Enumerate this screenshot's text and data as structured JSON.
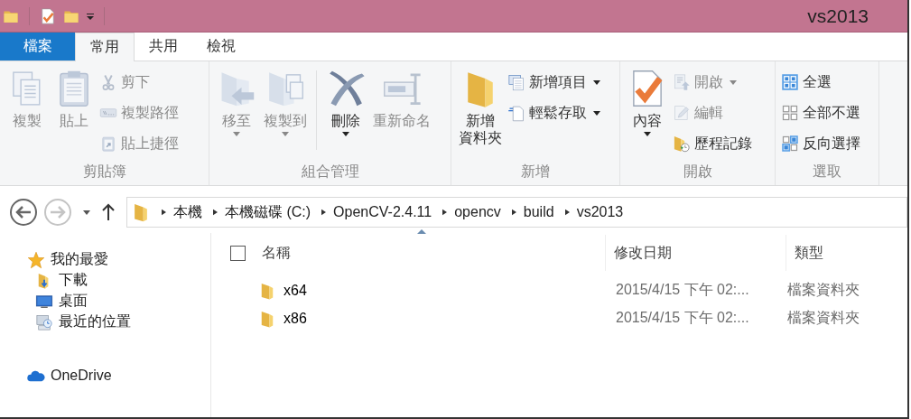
{
  "window": {
    "title": "vs2013"
  },
  "quick_access": [
    {
      "kind": "folder"
    },
    {
      "kind": "separator"
    },
    {
      "kind": "properties"
    },
    {
      "kind": "newfolder"
    },
    {
      "kind": "caret"
    }
  ],
  "tabs": [
    {
      "label": "檔案",
      "kind": "file",
      "selected": false
    },
    {
      "label": "常用",
      "kind": "tab",
      "selected": true
    },
    {
      "label": "共用",
      "kind": "tab",
      "selected": false
    },
    {
      "label": "檢視",
      "kind": "tab",
      "selected": false
    }
  ],
  "ribbon": {
    "groups": [
      {
        "label": "剪貼簿",
        "items": [
          {
            "kind": "large",
            "label": "複製",
            "disabled": true,
            "dropdown": false
          },
          {
            "kind": "large",
            "label": "貼上",
            "disabled": true,
            "dropdown": false
          },
          {
            "kind": "small",
            "label": "剪下",
            "disabled": true,
            "dropdown": false
          },
          {
            "kind": "small",
            "label": "複製路徑",
            "disabled": true,
            "dropdown": false
          },
          {
            "kind": "small",
            "label": "貼上捷徑",
            "disabled": true,
            "dropdown": false
          }
        ]
      },
      {
        "label": "組合管理",
        "items": [
          {
            "kind": "large",
            "label": "移至",
            "disabled": true,
            "dropdown": true
          },
          {
            "kind": "large",
            "label": "複製到",
            "disabled": true,
            "dropdown": true
          },
          {
            "kind": "separator"
          },
          {
            "kind": "large",
            "label": "刪除",
            "disabled": false,
            "dropdown": true
          },
          {
            "kind": "large",
            "label": "重新命名",
            "disabled": true,
            "dropdown": false
          }
        ]
      },
      {
        "label": "新增",
        "items": [
          {
            "kind": "large",
            "lines": [
              "新增",
              "資料夾"
            ],
            "disabled": false,
            "dropdown": false
          },
          {
            "kind": "small",
            "label": "新增項目",
            "disabled": false,
            "dropdown": true
          },
          {
            "kind": "small",
            "label": "輕鬆存取",
            "disabled": false,
            "dropdown": true
          }
        ]
      },
      {
        "label": "開啟",
        "items": [
          {
            "kind": "large",
            "label": "內容",
            "disabled": false,
            "dropdown": true
          },
          {
            "kind": "small",
            "label": "開啟",
            "disabled": true,
            "dropdown": true
          },
          {
            "kind": "small",
            "label": "編輯",
            "disabled": true,
            "dropdown": false
          },
          {
            "kind": "small",
            "label": "歷程記錄",
            "disabled": false,
            "dropdown": false
          }
        ]
      },
      {
        "label": "選取",
        "items": [
          {
            "kind": "small",
            "label": "全選",
            "disabled": false,
            "dropdown": false
          },
          {
            "kind": "small",
            "label": "全部不選",
            "disabled": false,
            "dropdown": false
          },
          {
            "kind": "small",
            "label": "反向選擇",
            "disabled": false,
            "dropdown": false
          }
        ]
      }
    ]
  },
  "navigation": {
    "back": {
      "disabled": false
    },
    "forward": {
      "disabled": true
    }
  },
  "address": {
    "crumbs": [
      "本機",
      "本機磁碟 (C:)",
      "OpenCV-2.4.11",
      "opencv",
      "build",
      "vs2013"
    ]
  },
  "sidebar": {
    "items": [
      {
        "label": "我的最愛",
        "kind": "favorites",
        "children": [
          {
            "label": "下載",
            "kind": "downloads"
          },
          {
            "label": "桌面",
            "kind": "desktop"
          },
          {
            "label": "最近的位置",
            "kind": "recent"
          }
        ]
      },
      {
        "label": "OneDrive",
        "kind": "cloud"
      }
    ]
  },
  "table": {
    "select_all": {
      "checked": false
    },
    "columns": [
      {
        "label": "名稱",
        "sorted": true
      },
      {
        "label": "修改日期",
        "sorted": false
      },
      {
        "label": "類型",
        "sorted": false
      }
    ],
    "rows": [
      {
        "name": "x64",
        "modified": "2015/4/15 下午 02:...",
        "type": "檔案資料夾"
      },
      {
        "name": "x86",
        "modified": "2015/4/15 下午 02:...",
        "type": "檔案資料夾"
      }
    ]
  }
}
